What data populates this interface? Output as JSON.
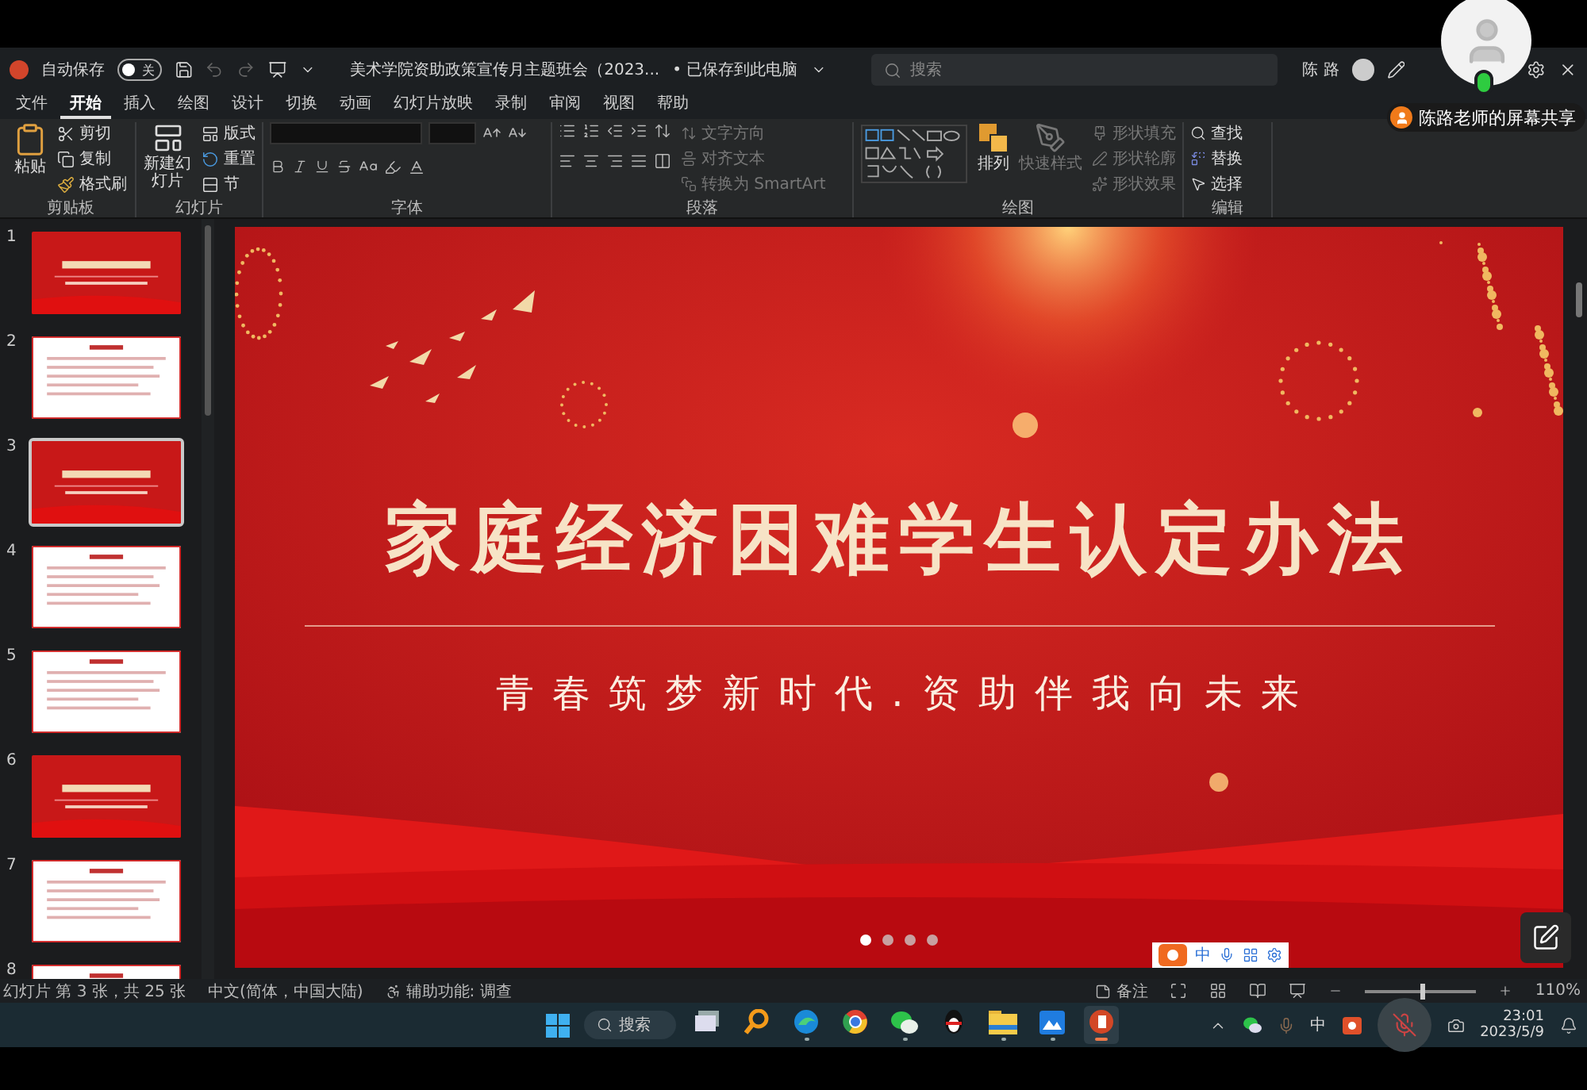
{
  "title_bar": {
    "autosave_label": "自动保存",
    "autosave_toggle": {
      "label": "关",
      "on": false
    },
    "document_title": "美术学院资助政策宣传月主题班会（2023...",
    "save_status": "• 已保存到此电脑",
    "search": {
      "placeholder": "搜索"
    },
    "user_name": "陈 路"
  },
  "screen_share_badge": "陈路老师的屏幕共享",
  "ribbon_tabs": [
    {
      "label": "文件",
      "selected": false
    },
    {
      "label": "开始",
      "selected": true
    },
    {
      "label": "插入",
      "selected": false
    },
    {
      "label": "绘图",
      "selected": false
    },
    {
      "label": "设计",
      "selected": false
    },
    {
      "label": "切换",
      "selected": false
    },
    {
      "label": "动画",
      "selected": false
    },
    {
      "label": "幻灯片放映",
      "selected": false
    },
    {
      "label": "录制",
      "selected": false
    },
    {
      "label": "审阅",
      "selected": false
    },
    {
      "label": "视图",
      "selected": false
    },
    {
      "label": "帮助",
      "selected": false
    }
  ],
  "ribbon": {
    "clipboard": {
      "name": "剪贴板",
      "paste": "粘贴",
      "cut": "剪切",
      "copy": "复制",
      "format_painter": "格式刷"
    },
    "slides": {
      "name": "幻灯片",
      "new_slide": "新建幻灯片",
      "layout": "版式",
      "reset": "重置",
      "section": "节"
    },
    "font": {
      "name": "字体"
    },
    "paragraph": {
      "name": "段落",
      "text_direction": "文字方向",
      "align_text": "对齐文本",
      "convert_smartart": "转换为 SmartArt"
    },
    "drawing": {
      "name": "绘图",
      "arrange": "排列",
      "quick_styles": "快速样式",
      "shape_fill": "形状填充",
      "shape_outline": "形状轮廓",
      "shape_effects": "形状效果"
    },
    "editing": {
      "name": "编辑",
      "find": "查找",
      "replace": "替换",
      "select": "选择"
    }
  },
  "thumbnails": [
    {
      "number": "1",
      "kind": "red",
      "selected": false
    },
    {
      "number": "2",
      "kind": "white",
      "selected": false
    },
    {
      "number": "3",
      "kind": "red",
      "selected": true
    },
    {
      "number": "4",
      "kind": "white",
      "selected": false
    },
    {
      "number": "5",
      "kind": "white",
      "selected": false
    },
    {
      "number": "6",
      "kind": "red",
      "selected": false
    },
    {
      "number": "7",
      "kind": "white",
      "selected": false
    },
    {
      "number": "8",
      "kind": "white",
      "selected": false
    }
  ],
  "slide": {
    "title": "家庭经济困难学生认定办法",
    "subtitle": "青 春 筑 梦 新 时 代 . 资 助 伴 我 向 未 来",
    "page_dots": [
      {
        "selected": true
      },
      {
        "selected": false
      },
      {
        "selected": false
      },
      {
        "selected": false
      }
    ]
  },
  "ime_toolbar": {
    "mode": "中"
  },
  "status_bar": {
    "slide_counter": "幻灯片 第 3 张，共 25 张",
    "language": "中文(简体，中国大陆)",
    "accessibility": "辅助功能: 调查",
    "notes": "备注",
    "zoom": "110%",
    "zoom_slider": {
      "level": 0.5
    }
  },
  "taskbar": {
    "search": "搜索",
    "apps": [
      {
        "kind": "stack",
        "running": false,
        "selected": false
      },
      {
        "kind": "magnifier",
        "running": false,
        "selected": false
      },
      {
        "kind": "wave",
        "running": true,
        "selected": false
      },
      {
        "kind": "round",
        "running": false,
        "selected": false
      },
      {
        "kind": "chat",
        "running": true,
        "selected": false
      },
      {
        "kind": "penguin",
        "running": false,
        "selected": false
      },
      {
        "kind": "folder",
        "running": true,
        "selected": false
      },
      {
        "kind": "gallery",
        "running": true,
        "selected": false
      },
      {
        "kind": "slides",
        "running": true,
        "selected": true
      }
    ],
    "input_mode": "中",
    "time": "23:01",
    "date": "2023/5/9"
  }
}
